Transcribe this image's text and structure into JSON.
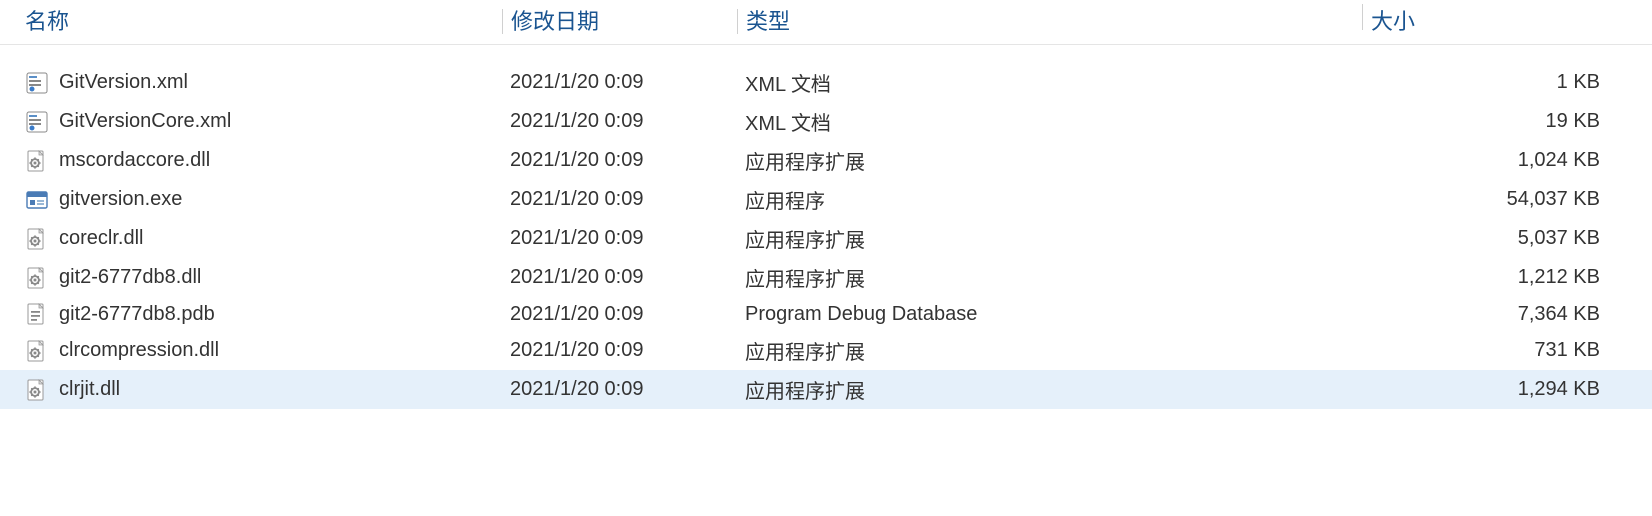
{
  "columns": {
    "name": "名称",
    "date": "修改日期",
    "type": "类型",
    "size": "大小"
  },
  "files": [
    {
      "icon": "xml",
      "name": "GitVersion.xml",
      "date": "2021/1/20 0:09",
      "type": "XML 文档",
      "size": "1 KB",
      "selected": false
    },
    {
      "icon": "xml",
      "name": "GitVersionCore.xml",
      "date": "2021/1/20 0:09",
      "type": "XML 文档",
      "size": "19 KB",
      "selected": false
    },
    {
      "icon": "dll",
      "name": "mscordaccore.dll",
      "date": "2021/1/20 0:09",
      "type": "应用程序扩展",
      "size": "1,024 KB",
      "selected": false
    },
    {
      "icon": "exe",
      "name": "gitversion.exe",
      "date": "2021/1/20 0:09",
      "type": "应用程序",
      "size": "54,037 KB",
      "selected": false
    },
    {
      "icon": "dll",
      "name": "coreclr.dll",
      "date": "2021/1/20 0:09",
      "type": "应用程序扩展",
      "size": "5,037 KB",
      "selected": false
    },
    {
      "icon": "dll",
      "name": "git2-6777db8.dll",
      "date": "2021/1/20 0:09",
      "type": "应用程序扩展",
      "size": "1,212 KB",
      "selected": false
    },
    {
      "icon": "pdb",
      "name": "git2-6777db8.pdb",
      "date": "2021/1/20 0:09",
      "type": "Program Debug Database",
      "size": "7,364 KB",
      "selected": false
    },
    {
      "icon": "dll",
      "name": "clrcompression.dll",
      "date": "2021/1/20 0:09",
      "type": "应用程序扩展",
      "size": "731 KB",
      "selected": false
    },
    {
      "icon": "dll",
      "name": "clrjit.dll",
      "date": "2021/1/20 0:09",
      "type": "应用程序扩展",
      "size": "1,294 KB",
      "selected": true
    }
  ]
}
